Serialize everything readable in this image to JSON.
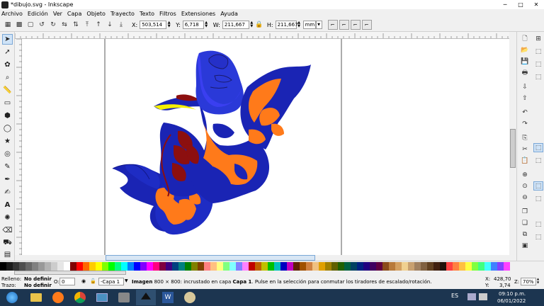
{
  "window": {
    "title": "*dibujo.svg - Inkscape",
    "minimize": "─",
    "maximize": "□",
    "close": "✕"
  },
  "menu": [
    "Archivo",
    "Edición",
    "Ver",
    "Capa",
    "Objeto",
    "Trayecto",
    "Texto",
    "Filtros",
    "Extensiones",
    "Ayuda"
  ],
  "toolbar": {
    "x_label": "X:",
    "x_value": "503,514",
    "y_label": "Y:",
    "y_value": "6,718",
    "w_label": "W:",
    "w_value": "211,667",
    "h_label": "H:",
    "h_value": "211,667",
    "unit": "mm"
  },
  "status": {
    "fill_label": "Relleno:",
    "fill_value": "No definir",
    "stroke_label": "Trazo:",
    "stroke_value": "No definir",
    "opacity_label": "O:",
    "opacity_value": "0",
    "layer": "-Capa 1",
    "message_bold": "Imagen",
    "message_rest": " 800 × 800: incrustado en capa ",
    "message_layer": "Capa 1",
    "message_tail": ". Pulse en la selección para conmutar los tiradores de escalado/rotación.",
    "coord_x_label": "X:",
    "coord_x": "428,70",
    "coord_y_label": "Y:",
    "coord_y": "3,74",
    "zoom_label": "Z:",
    "zoom": "70%"
  },
  "taskbar": {
    "lang": "ES",
    "time": "09:10 p.m.",
    "date": "06/01/2022"
  },
  "colors": {
    "blue_dark": "#1a24b4",
    "blue_mid": "#2a39d8",
    "blue_light": "#3a3ff0",
    "orange": "#ff7a1a",
    "maroon": "#8c0f0f",
    "yellow": "#f5ef00"
  },
  "palette_colors": [
    "#000000",
    "#1a1a1a",
    "#333333",
    "#4d4d4d",
    "#666666",
    "#808080",
    "#999999",
    "#b3b3b3",
    "#cccccc",
    "#e6e6e6",
    "#ffffff",
    "#800000",
    "#ff0000",
    "#ff6600",
    "#ffcc00",
    "#ffff00",
    "#80ff00",
    "#00ff00",
    "#00ff80",
    "#00ffff",
    "#0080ff",
    "#0000ff",
    "#8000ff",
    "#ff00ff",
    "#ff0080",
    "#800040",
    "#400080",
    "#004080",
    "#008080",
    "#008000",
    "#808000",
    "#804000",
    "#ff8080",
    "#ffc080",
    "#ffff80",
    "#80ff80",
    "#80ffff",
    "#8080ff",
    "#ff80ff",
    "#c00000",
    "#c06000",
    "#c0c000",
    "#00c000",
    "#00c0c0",
    "#0000c0",
    "#c000c0",
    "#602000",
    "#a05000",
    "#d08040",
    "#f0c080",
    "#e0a000",
    "#a08000",
    "#606000",
    "#206000",
    "#006040",
    "#004060",
    "#002080",
    "#200080",
    "#400060",
    "#600040",
    "#8a4a1a",
    "#b87a3a",
    "#d4a060",
    "#f0d090",
    "#c8a070",
    "#a08060",
    "#806040",
    "#604020",
    "#402010",
    "#201008",
    "#ff4040",
    "#ff8040",
    "#ffc040",
    "#ffff40",
    "#80ff40",
    "#40ff80",
    "#40ffff",
    "#4080ff",
    "#8040ff",
    "#ff40ff"
  ]
}
